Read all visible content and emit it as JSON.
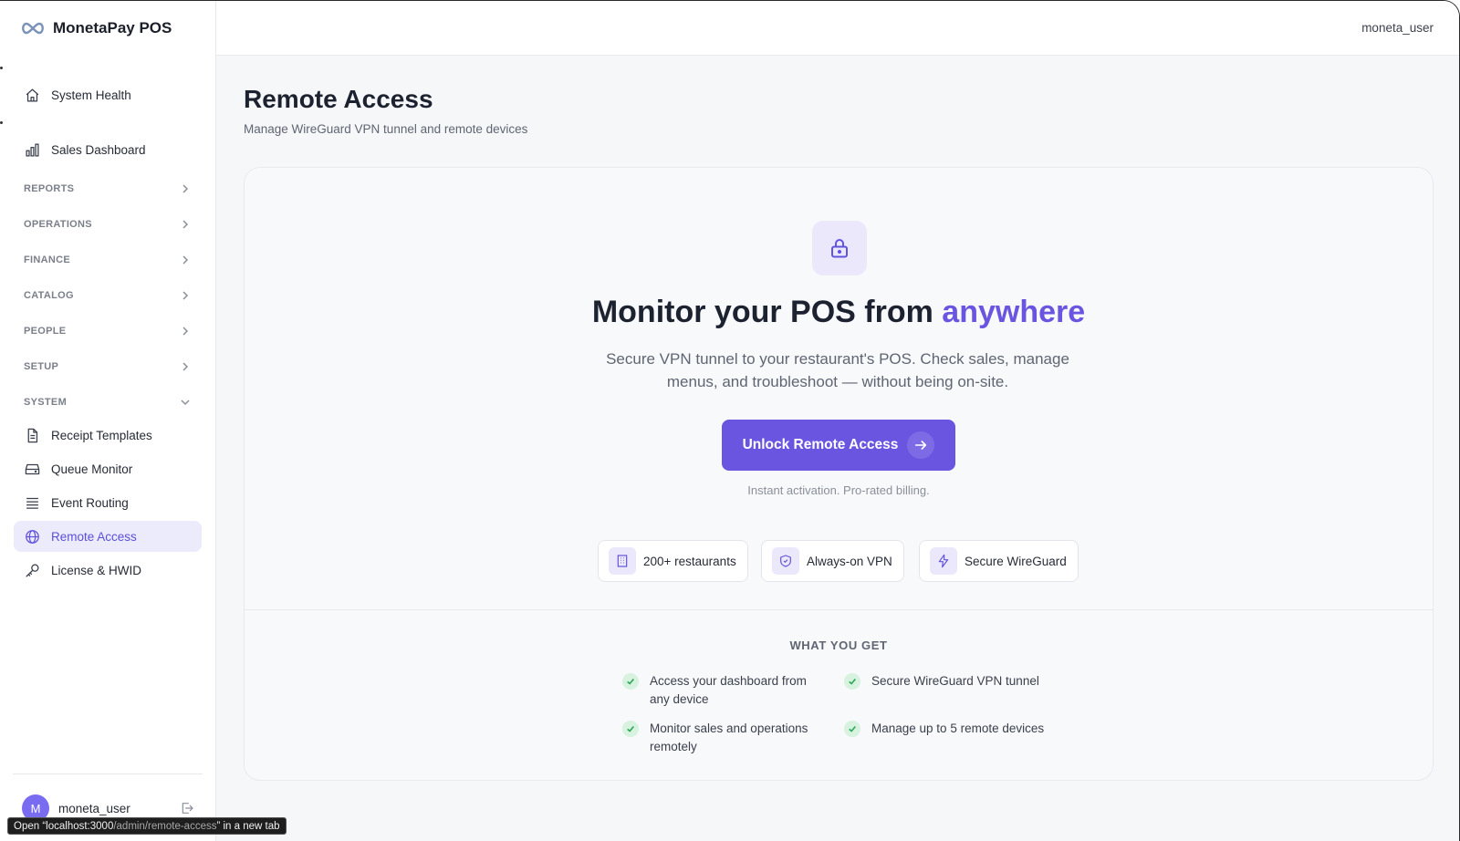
{
  "app": {
    "name": "MonetaPay POS"
  },
  "sidebar": {
    "items": [
      {
        "label": "System Health",
        "icon": "home-icon"
      },
      {
        "label": "Sales Dashboard",
        "icon": "bar-chart-icon"
      }
    ],
    "sections": [
      {
        "label": "REPORTS",
        "expanded": false
      },
      {
        "label": "OPERATIONS",
        "expanded": false
      },
      {
        "label": "FINANCE",
        "expanded": false
      },
      {
        "label": "CATALOG",
        "expanded": false
      },
      {
        "label": "PEOPLE",
        "expanded": false
      },
      {
        "label": "SETUP",
        "expanded": false
      },
      {
        "label": "SYSTEM",
        "expanded": true
      }
    ],
    "system_items": [
      {
        "label": "Receipt Templates",
        "icon": "document-icon"
      },
      {
        "label": "Queue Monitor",
        "icon": "inbox-icon"
      },
      {
        "label": "Event Routing",
        "icon": "list-icon"
      },
      {
        "label": "Remote Access",
        "icon": "globe-icon",
        "active": true
      },
      {
        "label": "License & HWID",
        "icon": "key-icon"
      }
    ],
    "user": {
      "initial": "M",
      "name": "moneta_user"
    }
  },
  "topbar": {
    "user": "moneta_user"
  },
  "page": {
    "title": "Remote Access",
    "subtitle": "Manage WireGuard VPN tunnel and remote devices"
  },
  "hero": {
    "title_prefix": "Monitor your POS from ",
    "title_accent": "anywhere",
    "description": "Secure VPN tunnel to your restaurant's POS. Check sales, manage menus, and troubleshoot — without being on-site.",
    "cta_label": "Unlock Remote Access",
    "cta_note": "Instant activation. Pro-rated billing."
  },
  "badges": [
    {
      "label": "200+ restaurants",
      "icon": "building-icon"
    },
    {
      "label": "Always-on VPN",
      "icon": "shield-icon"
    },
    {
      "label": "Secure WireGuard",
      "icon": "lightning-icon"
    }
  ],
  "what_you_get": {
    "title": "WHAT YOU GET",
    "features": [
      "Access your dashboard from any device",
      "Secure WireGuard VPN tunnel",
      "Monitor sales and operations remotely",
      "Manage up to 5 remote devices"
    ]
  },
  "status_tip": {
    "prefix": "Open “",
    "host": "localhost:3000",
    "path": "/admin/remote-access",
    "suffix": "” in a new tab"
  },
  "colors": {
    "accent": "#6a55e0",
    "active_bg": "#ecebfc",
    "check_green": "#2fa85a"
  }
}
